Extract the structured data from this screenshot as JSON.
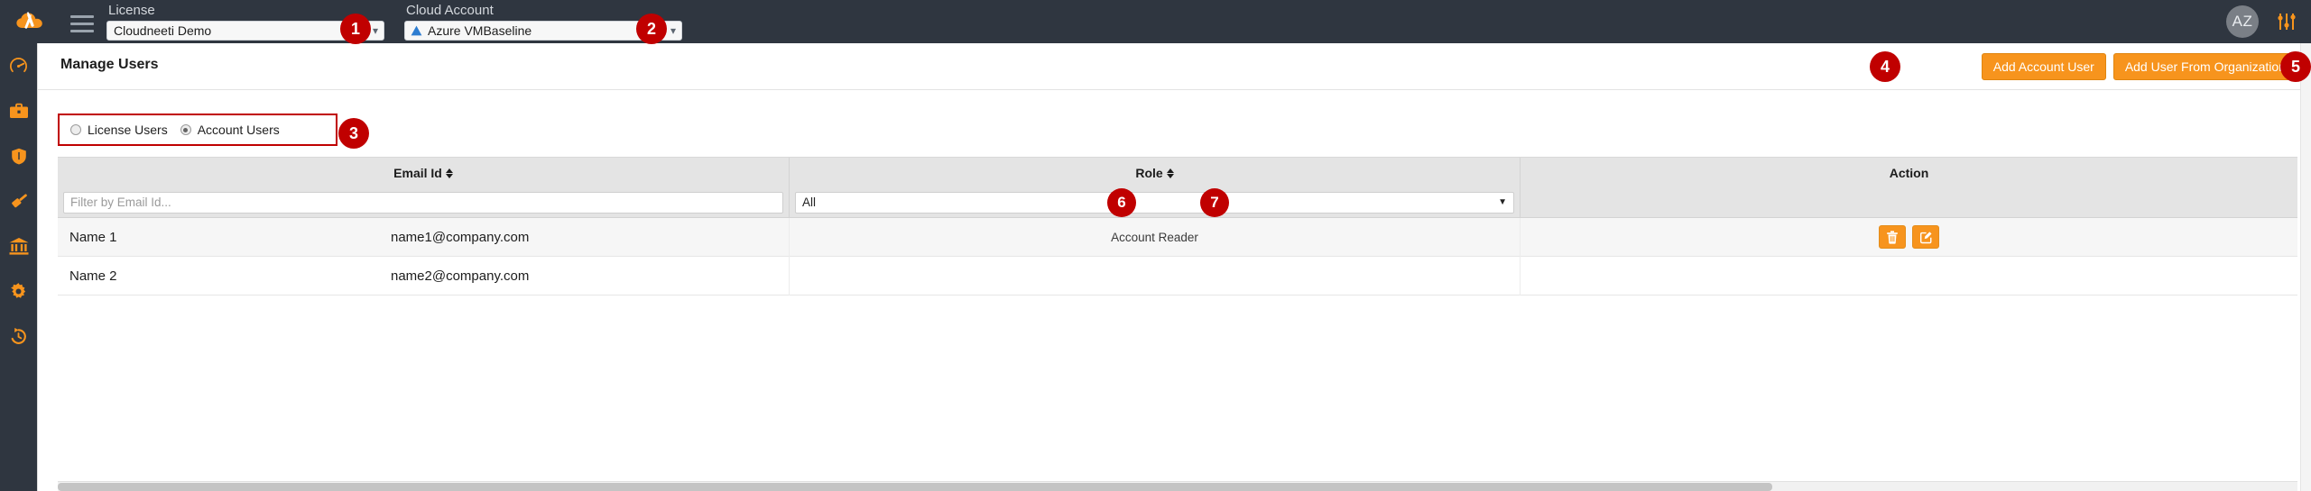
{
  "topbar": {
    "logo_icon": "cloud-tools-logo",
    "menu_icon": "hamburger-menu-icon",
    "license": {
      "label": "License",
      "value": "Cloudneeti Demo",
      "caret_icon": "chevron-down-icon"
    },
    "cloud_account": {
      "label": "Cloud Account",
      "value": "Azure VMBaseline",
      "provider_icon": "azure-icon",
      "caret_icon": "chevron-down-icon"
    },
    "avatar_initials": "AZ",
    "settings_icon": "sliders-icon"
  },
  "sidebar": {
    "items": [
      {
        "icon": "dashboard-gauge-icon",
        "name": "dashboard"
      },
      {
        "icon": "briefcase-icon",
        "name": "portfolio"
      },
      {
        "icon": "shield-icon",
        "name": "security"
      },
      {
        "icon": "gavel-icon",
        "name": "compliance"
      },
      {
        "icon": "bank-icon",
        "name": "governance"
      },
      {
        "icon": "gear-icon",
        "name": "settings"
      },
      {
        "icon": "history-clock-icon",
        "name": "history"
      }
    ]
  },
  "page": {
    "title": "Manage Users",
    "actions": [
      {
        "label": "Add Account User",
        "name": "add-account-user-button"
      },
      {
        "label": "Add User From Organization",
        "name": "add-user-from-organization-button"
      }
    ]
  },
  "user_scope": {
    "options": [
      {
        "label": "License Users",
        "selected": false
      },
      {
        "label": "Account Users",
        "selected": true
      }
    ]
  },
  "table": {
    "columns": [
      {
        "label": "Email Id",
        "sortable": true
      },
      {
        "label": "Role",
        "sortable": true
      },
      {
        "label": "Action",
        "sortable": false
      }
    ],
    "filters": {
      "email_placeholder": "Filter by Email Id...",
      "email_value": "",
      "role_value": "All"
    },
    "rows": [
      {
        "name": "Name 1",
        "email": "name1@company.com",
        "role": "Account Reader"
      },
      {
        "name": "Name 2",
        "email": "name2@company.com",
        "role": ""
      }
    ],
    "row_actions": [
      {
        "icon": "trash-icon",
        "name": "delete-user-button"
      },
      {
        "icon": "edit-pencil-icon",
        "name": "edit-user-button"
      }
    ]
  },
  "callouts": [
    {
      "n": "1"
    },
    {
      "n": "2"
    },
    {
      "n": "3"
    },
    {
      "n": "4"
    },
    {
      "n": "5"
    },
    {
      "n": "6"
    },
    {
      "n": "7"
    }
  ],
  "colors": {
    "brand_orange": "#f7941d",
    "dark_navy": "#2f3640",
    "callout_red": "#c00000",
    "azure_blue": "#2e7dd1"
  }
}
